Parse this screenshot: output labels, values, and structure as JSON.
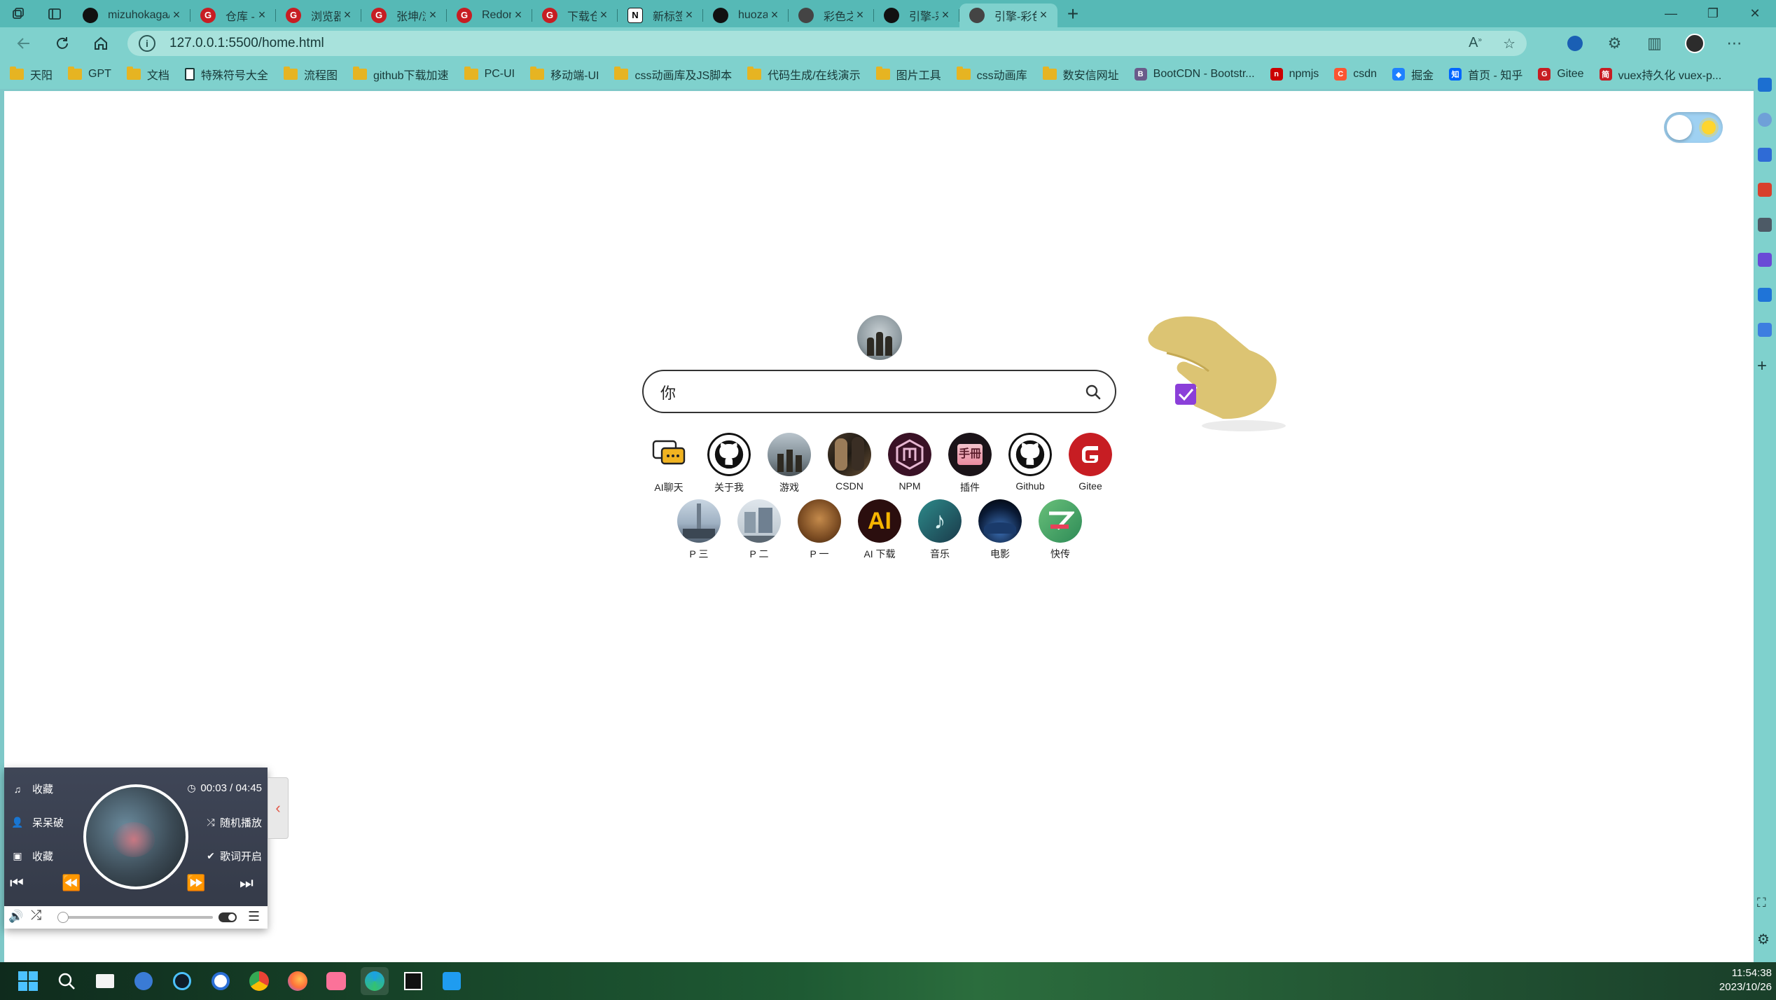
{
  "tabs": [
    {
      "title": "mizuhokaga/jsplu",
      "icon": "github"
    },
    {
      "title": "仓库 - 张坤 (zhan",
      "icon": "gitee"
    },
    {
      "title": "浏览器_集合Chart",
      "icon": "gitee"
    },
    {
      "title": "张坤/浏览器_集合",
      "icon": "gitee"
    },
    {
      "title": "Redon (red_don)",
      "icon": "gitee"
    },
    {
      "title": "下载仓库 - Redon",
      "icon": "gitee"
    },
    {
      "title": "新标签页",
      "icon": "notion"
    },
    {
      "title": "huozaifenlangli",
      "icon": "github"
    },
    {
      "title": "彩色之外",
      "icon": "color"
    },
    {
      "title": "引擎-彩色之外",
      "icon": "github"
    },
    {
      "title": "引擎-彩色之外",
      "icon": "color",
      "active": true
    }
  ],
  "address": {
    "url": "127.0.0.1:5500/home.html"
  },
  "bookmarks": [
    {
      "label": "天阳",
      "icon": "folder"
    },
    {
      "label": "GPT",
      "icon": "folder"
    },
    {
      "label": "文档",
      "icon": "folder"
    },
    {
      "label": "特殊符号大全",
      "icon": "doc"
    },
    {
      "label": "流程图",
      "icon": "folder"
    },
    {
      "label": "github下载加速",
      "icon": "folder"
    },
    {
      "label": "PC-UI",
      "icon": "folder"
    },
    {
      "label": "移动端-UI",
      "icon": "folder"
    },
    {
      "label": "css动画库及JS脚本",
      "icon": "folder"
    },
    {
      "label": "代码生成/在线演示",
      "icon": "folder"
    },
    {
      "label": "图片工具",
      "icon": "folder"
    },
    {
      "label": "css动画库",
      "icon": "folder"
    },
    {
      "label": "数安信网址",
      "icon": "folder"
    },
    {
      "label": "BootCDN - Bootstr...",
      "icon": "site",
      "color": "#6a5b8a",
      "glyph": "B"
    },
    {
      "label": "npmjs",
      "icon": "site",
      "color": "#cb0000",
      "glyph": "n"
    },
    {
      "label": "csdn",
      "icon": "site",
      "color": "#fc5531",
      "glyph": "C"
    },
    {
      "label": "掘金",
      "icon": "site",
      "color": "#1e80ff",
      "glyph": "◆"
    },
    {
      "label": "首页 - 知乎",
      "icon": "site",
      "color": "#0066ff",
      "glyph": "知"
    },
    {
      "label": "Gitee",
      "icon": "site",
      "color": "#c71d23",
      "glyph": "G"
    },
    {
      "label": "vuex持久化 vuex-p...",
      "icon": "site",
      "color": "#c71d23",
      "glyph": "简"
    }
  ],
  "search": {
    "value": "你"
  },
  "links_row1": [
    {
      "label": "AI聊天",
      "kind": "chat"
    },
    {
      "label": "关于我",
      "kind": "github"
    },
    {
      "label": "游戏",
      "kind": "photo-game"
    },
    {
      "label": "CSDN",
      "kind": "photo-csdn"
    },
    {
      "label": "NPM",
      "kind": "npm"
    },
    {
      "label": "插件",
      "kind": "plugin"
    },
    {
      "label": "Github",
      "kind": "github"
    },
    {
      "label": "Gitee",
      "kind": "gitee"
    }
  ],
  "links_row2": [
    {
      "label": "P 三",
      "kind": "photo-city"
    },
    {
      "label": "P 二",
      "kind": "photo-build"
    },
    {
      "label": "P 一",
      "kind": "photo-brown"
    },
    {
      "label": "AI 下载",
      "kind": "ai"
    },
    {
      "label": "音乐",
      "kind": "music"
    },
    {
      "label": "电影",
      "kind": "movie"
    },
    {
      "label": "快传",
      "kind": "wps"
    }
  ],
  "player": {
    "title": "收藏",
    "artist": "呆呆破",
    "album": "收藏",
    "time": "00:03 / 04:45",
    "mode": "随机播放",
    "lyrics": "歌词开启",
    "progress": 0.02
  },
  "clock": {
    "time": "11:54:38",
    "date": "2023/10/26"
  },
  "colors": {
    "browser_chrome": "#7fd1cd",
    "tabstrip": "#56b9b6",
    "player_bg": "#3a4150",
    "accent_red": "#e25a4a"
  }
}
